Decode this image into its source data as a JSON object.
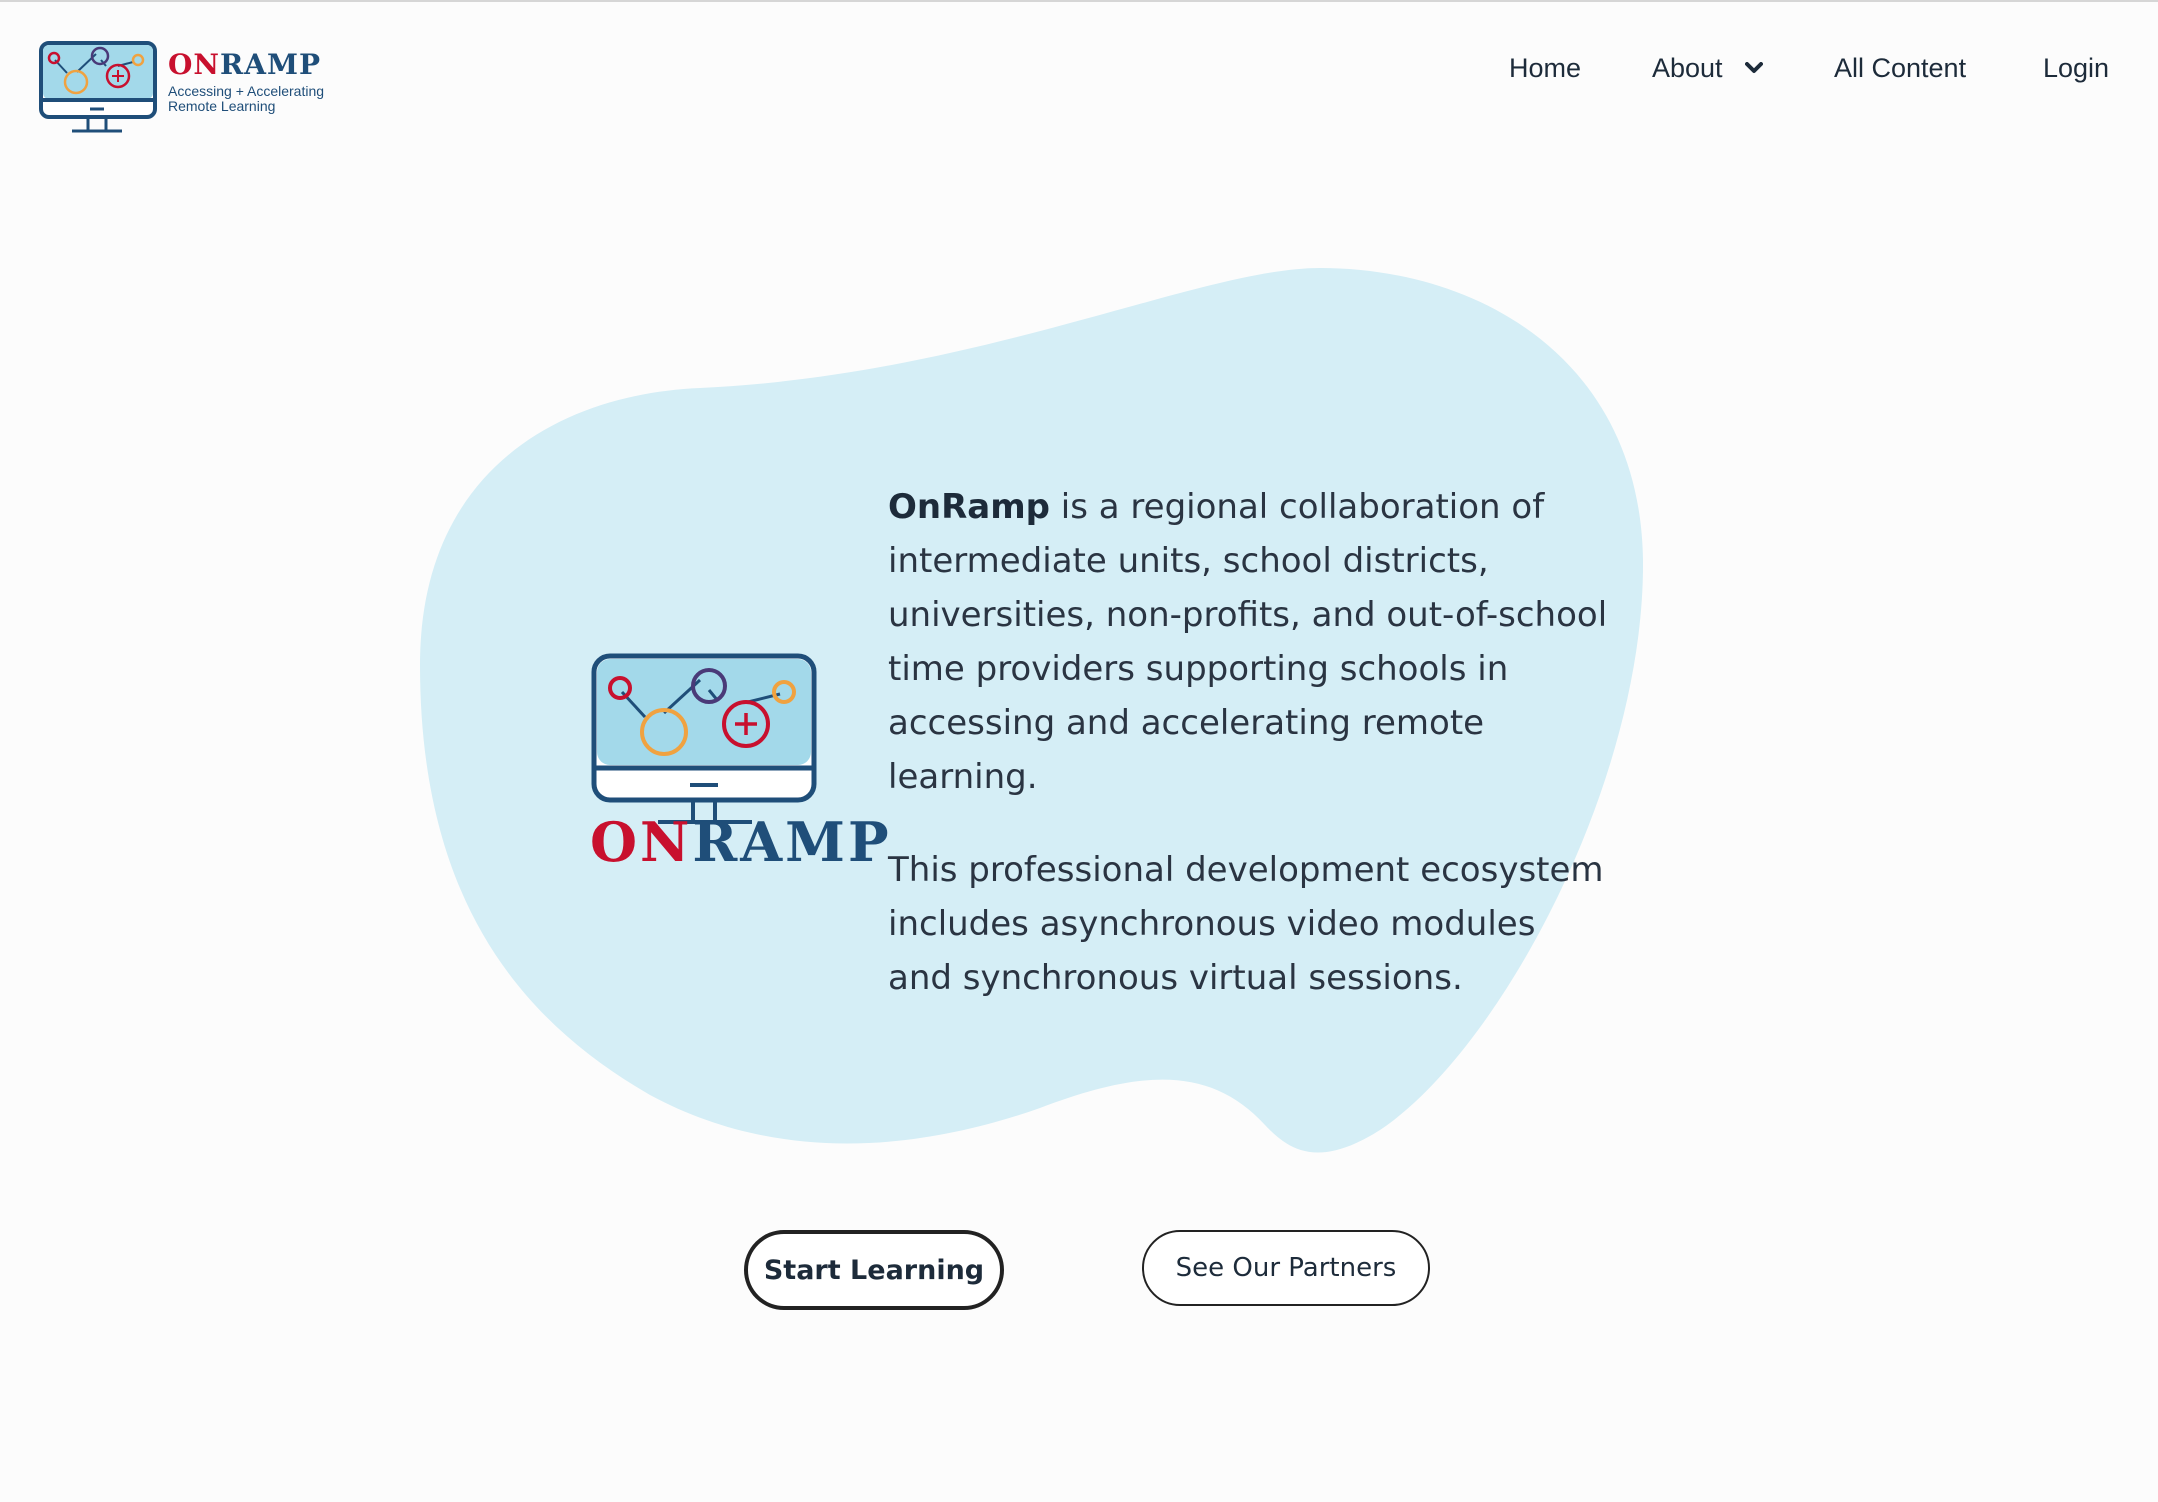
{
  "header": {
    "logo": {
      "word_on": "ON",
      "word_ramp": "RAMP",
      "tagline_line1": "Accessing + Accelerating",
      "tagline_line2": "Remote Learning"
    },
    "nav": {
      "home": "Home",
      "about": "About",
      "all_content": "All Content",
      "login": "Login"
    }
  },
  "hero": {
    "logo_word_on": "ON",
    "logo_word_ramp": "RAMP",
    "brand": "OnRamp",
    "paragraph1_rest": " is a regional collaboration of intermediate units, school districts, universities, non-profits, and out-of-school time providers supporting schools in accessing and accelerating remote learning.",
    "paragraph2": "This professional development ecosystem includes asynchronous video modules and synchronous virtual sessions."
  },
  "buttons": {
    "start_learning": "Start Learning",
    "see_partners": "See Our Partners"
  },
  "colors": {
    "blob": "#d5eef6",
    "brand_red": "#c8102e",
    "brand_blue": "#1f4e79",
    "screen_fill": "#a3d9ea",
    "orange": "#f0a240",
    "purple": "#4a3a78"
  },
  "icons": [
    "chevron-down-icon",
    "monitor-logo-icon"
  ]
}
